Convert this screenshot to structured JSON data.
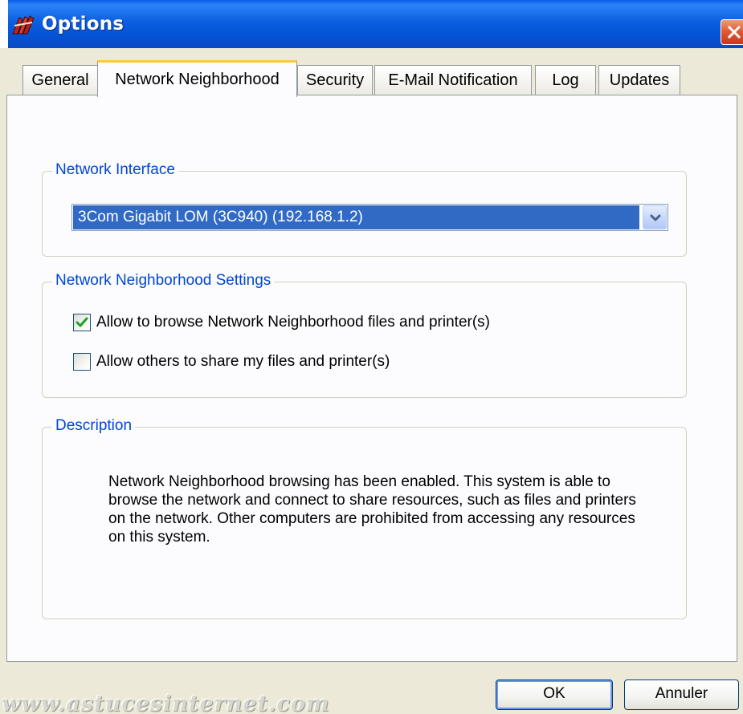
{
  "window": {
    "title": "Options",
    "colors": {
      "titlebar": "#0A5BE8",
      "legend_text": "#0046D5",
      "selection": "#316AC5",
      "tab_highlight": "#FFC83C",
      "close_button": "#E35A35"
    }
  },
  "tabs": [
    {
      "label": "General"
    },
    {
      "label": "Network Neighborhood"
    },
    {
      "label": "Security"
    },
    {
      "label": "E-Mail Notification"
    },
    {
      "label": "Log"
    },
    {
      "label": "Updates"
    }
  ],
  "active_tab": "Network Neighborhood",
  "network_interface": {
    "legend": "Network Interface",
    "selected": "3Com Gigabit LOM (3C940) (192.168.1.2)"
  },
  "nn_settings": {
    "legend": "Network Neighborhood Settings",
    "options": [
      {
        "label": "Allow to browse Network Neighborhood files and printer(s)",
        "checked": true
      },
      {
        "label": "Allow others to share my files and printer(s)",
        "checked": false
      }
    ]
  },
  "description": {
    "legend": "Description",
    "text": "Network Neighborhood browsing has been enabled.  This system is able to browse the network and connect to share resources, such as files and printers on the network. Other computers are prohibited from accessing any resources on this system."
  },
  "buttons": {
    "ok": "OK",
    "cancel": "Annuler"
  },
  "watermark": "www.astucesinternet.com",
  "icons": {
    "app": "options-app-icon",
    "close": "close-icon",
    "dropdown": "chevron-down-icon",
    "check": "checkmark-icon"
  }
}
